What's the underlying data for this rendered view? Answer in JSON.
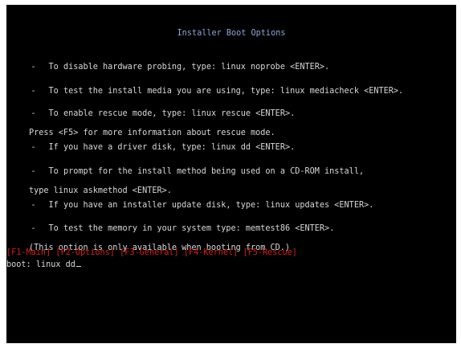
{
  "screen": {
    "title": "Installer Boot Options",
    "options": [
      {
        "lines": [
          "To disable hardware probing, type: linux noprobe <ENTER>."
        ]
      },
      {
        "lines": [
          "To test the install media you are using, type: linux mediacheck <ENTER>."
        ]
      },
      {
        "lines": [
          "To enable rescue mode, type: linux rescue <ENTER>.",
          "Press <F5> for more information about rescue mode."
        ]
      },
      {
        "lines": [
          "If you have a driver disk, type: linux dd <ENTER>."
        ]
      },
      {
        "lines": [
          "To prompt for the install method being used on a CD-ROM install,",
          "type linux askmethod <ENTER>."
        ]
      },
      {
        "lines": [
          "If you have an installer update disk, type: linux updates <ENTER>."
        ]
      },
      {
        "lines": [
          "To test the memory in your system type: memtest86 <ENTER>.",
          "(This option is only available when booting from CD.)"
        ]
      }
    ],
    "function_keys": [
      "[F1-Main]",
      "[F2-Options]",
      "[F3-General]",
      "[F4-Kernel]",
      "[F5-Rescue]"
    ],
    "prompt": {
      "label": "boot:",
      "value": "linux dd"
    },
    "colors": {
      "background": "#000000",
      "text": "#d8d8d8",
      "title": "#8ea6d8",
      "function_keys": "#d81e1e"
    }
  }
}
